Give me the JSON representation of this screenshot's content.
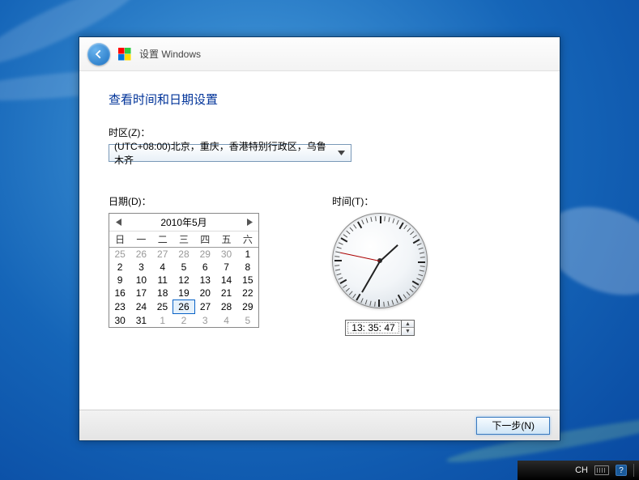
{
  "header": {
    "title": "设置 Windows"
  },
  "heading": "查看时间和日期设置",
  "timezone": {
    "label": "时区(Z)：",
    "selected": "(UTC+08:00)北京，重庆，香港特别行政区，乌鲁木齐"
  },
  "date": {
    "label": "日期(D)：",
    "month_title": "2010年5月",
    "weekdays": [
      "日",
      "一",
      "二",
      "三",
      "四",
      "五",
      "六"
    ],
    "grid": [
      [
        {
          "d": 25,
          "dim": true
        },
        {
          "d": 26,
          "dim": true
        },
        {
          "d": 27,
          "dim": true
        },
        {
          "d": 28,
          "dim": true
        },
        {
          "d": 29,
          "dim": true
        },
        {
          "d": 30,
          "dim": true
        },
        {
          "d": 1
        }
      ],
      [
        {
          "d": 2
        },
        {
          "d": 3
        },
        {
          "d": 4
        },
        {
          "d": 5
        },
        {
          "d": 6
        },
        {
          "d": 7
        },
        {
          "d": 8
        }
      ],
      [
        {
          "d": 9
        },
        {
          "d": 10
        },
        {
          "d": 11
        },
        {
          "d": 12
        },
        {
          "d": 13
        },
        {
          "d": 14
        },
        {
          "d": 15
        }
      ],
      [
        {
          "d": 16
        },
        {
          "d": 17
        },
        {
          "d": 18
        },
        {
          "d": 19
        },
        {
          "d": 20
        },
        {
          "d": 21
        },
        {
          "d": 22
        }
      ],
      [
        {
          "d": 23
        },
        {
          "d": 24
        },
        {
          "d": 25
        },
        {
          "d": 26,
          "sel": true
        },
        {
          "d": 27
        },
        {
          "d": 28
        },
        {
          "d": 29
        }
      ],
      [
        {
          "d": 30
        },
        {
          "d": 31
        },
        {
          "d": 1,
          "dim": true
        },
        {
          "d": 2,
          "dim": true
        },
        {
          "d": 3,
          "dim": true
        },
        {
          "d": 4,
          "dim": true
        },
        {
          "d": 5,
          "dim": true
        }
      ]
    ]
  },
  "time": {
    "label": "时间(T)：",
    "value": "13: 35: 47",
    "hours": 13,
    "minutes": 35,
    "seconds": 47
  },
  "footer": {
    "next": "下一步(N)"
  },
  "taskbar": {
    "lang": "CH"
  }
}
